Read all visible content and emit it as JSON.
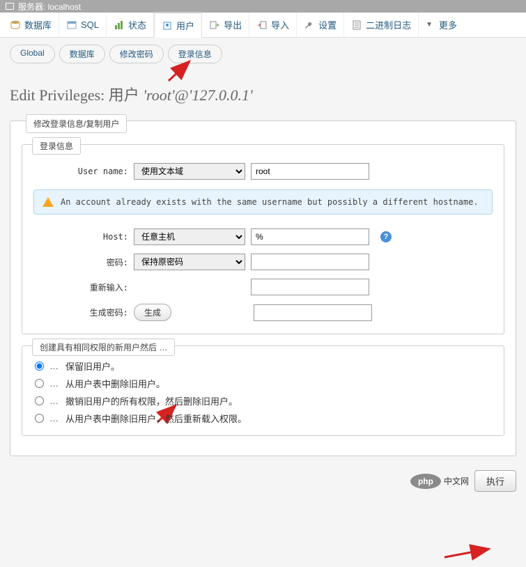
{
  "topbar": {
    "server_label": "服务器: localhost"
  },
  "main_tabs": [
    {
      "label": "数据库",
      "key": "database"
    },
    {
      "label": "SQL",
      "key": "sql"
    },
    {
      "label": "状态",
      "key": "status"
    },
    {
      "label": "用户",
      "key": "users",
      "active": true
    },
    {
      "label": "导出",
      "key": "export"
    },
    {
      "label": "导入",
      "key": "import"
    },
    {
      "label": "设置",
      "key": "settings"
    },
    {
      "label": "二进制日志",
      "key": "binlog"
    },
    {
      "label": "更多",
      "key": "more"
    }
  ],
  "sub_tabs": [
    {
      "label": "Global",
      "key": "global"
    },
    {
      "label": "数据库",
      "key": "db"
    },
    {
      "label": "修改密码",
      "key": "changepw"
    },
    {
      "label": "登录信息",
      "key": "login"
    }
  ],
  "heading": {
    "prefix": "Edit Privileges: 用户 ",
    "username": "'root'@'127.0.0.1'"
  },
  "outer_fieldset_legend": "修改登录信息/复制用户",
  "login_fieldset_legend": "登录信息",
  "form": {
    "username_label": "User name:",
    "username_select": "使用文本域",
    "username_value": "root",
    "host_label": "Host:",
    "host_select": "任意主机",
    "host_value": "%",
    "password_label": "密码:",
    "password_select": "保持原密码",
    "password_value": "",
    "retype_label": "重新输入:",
    "retype_value": "",
    "generate_label": "生成密码:",
    "generate_button": "生成",
    "generate_value": ""
  },
  "warning_text": "An account already exists with the same username but possibly a different hostname.",
  "after_fieldset_legend": "创建具有相同权限的新用户然后 …",
  "after_options": [
    "保留旧用户。",
    "从用户表中删除旧用户。",
    "撤销旧用户的所有权限，然后删除旧用户。",
    "从用户表中删除旧用户，然后重新载入权限。"
  ],
  "footer": {
    "php_label": "php",
    "php_text": "中文网",
    "exec_label": "执行"
  }
}
